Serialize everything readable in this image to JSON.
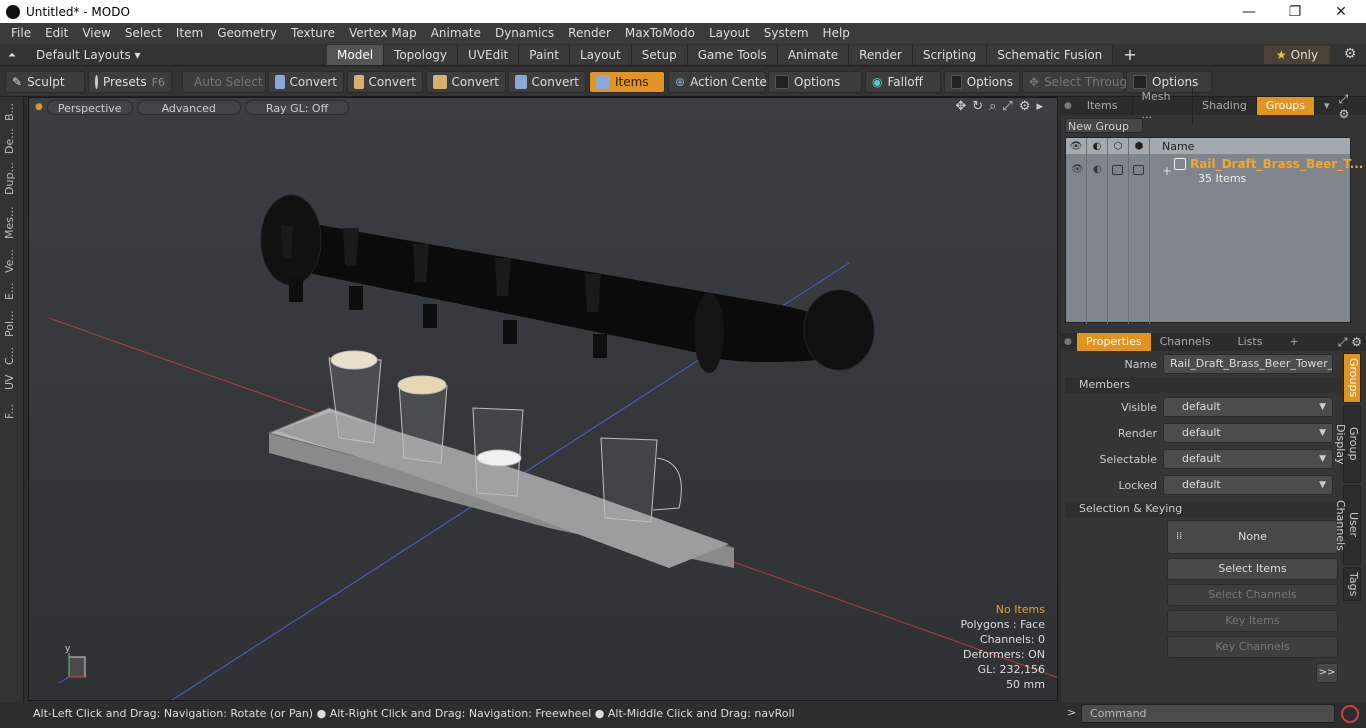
{
  "window": {
    "title": "Untitled* - MODO",
    "minimize": "—",
    "maximize": "❐",
    "close": "✕"
  },
  "menu": [
    "File",
    "Edit",
    "View",
    "Select",
    "Item",
    "Geometry",
    "Texture",
    "Vertex Map",
    "Animate",
    "Dynamics",
    "Render",
    "MaxToModo",
    "Layout",
    "System",
    "Help"
  ],
  "layouts": {
    "selector": "Default Layouts ▾",
    "tabs": [
      "Model",
      "Topology",
      "UVEdit",
      "Paint",
      "Layout",
      "Setup",
      "Game Tools",
      "Animate",
      "Render",
      "Scripting",
      "Schematic Fusion"
    ],
    "active": "Model",
    "plus": "+",
    "only": "Only",
    "only_icon": "★"
  },
  "toolbar": {
    "sculpt": "Sculpt",
    "presets": "Presets",
    "presets_key": "F6",
    "auto_select": "Auto Select",
    "convert1": "Convert",
    "convert2": "Convert",
    "convert3": "Convert",
    "convert4": "Convert",
    "items": "Items",
    "action_center": "Action Center",
    "options1": "Options",
    "falloff": "Falloff",
    "options2": "Options",
    "select_through": "Select Through",
    "options3": "Options"
  },
  "left_tabs": [
    "B...",
    "De...",
    "Dup...",
    "Mes...",
    "Ve...",
    "E...",
    "Pol...",
    "C...",
    "UV",
    "F..."
  ],
  "viewport": {
    "perspective": "Perspective",
    "advanced": "Advanced",
    "raygl": "Ray GL: Off",
    "info": {
      "no_items": "No Items",
      "polygons": "Polygons : Face",
      "channels": "Channels: 0",
      "deformers": "Deformers: ON",
      "gl": "GL: 232,156",
      "size": "50 mm"
    },
    "axis": {
      "x": "x",
      "y": "y",
      "z": "z"
    },
    "colors": {
      "accent": "#e3931f",
      "red_axis": "#b83c3c",
      "blue_axis": "#4a5fd0"
    }
  },
  "status": "Alt-Left Click and Drag: Navigation: Rotate (or Pan) ● Alt-Right Click and Drag: Navigation: Freewheel ● Alt-Middle Click and Drag: navRoll",
  "right": {
    "tabs": [
      "Items",
      "Mesh ...",
      "Shading",
      "Groups"
    ],
    "active_tab": "Groups",
    "dropdown": "▾",
    "new_group": "New Group",
    "list_header": {
      "name": "Name"
    },
    "group": {
      "name": "Rail_Draft_Brass_Beer_T...",
      "count": "35 Items",
      "expand": "+"
    },
    "prop_tabs": [
      "Properties",
      "Channels",
      "Lists"
    ],
    "prop_plus": "+",
    "name_label": "Name",
    "name_value": "Rail_Draft_Brass_Beer_Tower_w",
    "members_header": "Members",
    "fields": [
      {
        "label": "Visible",
        "value": "default"
      },
      {
        "label": "Render",
        "value": "default"
      },
      {
        "label": "Selectable",
        "value": "default"
      },
      {
        "label": "Locked",
        "value": "default"
      }
    ],
    "sel_header": "Selection & Keying",
    "none": "None",
    "select_items": "Select Items",
    "select_channels": "Select Channels",
    "key_items": "Key Items",
    "key_channels": "Key Channels",
    "more": ">>",
    "vtabs": [
      "Groups",
      "Group Display",
      "User Channels",
      "Tags"
    ]
  },
  "command": {
    "placeholder": "Command",
    "prompt": ">"
  }
}
